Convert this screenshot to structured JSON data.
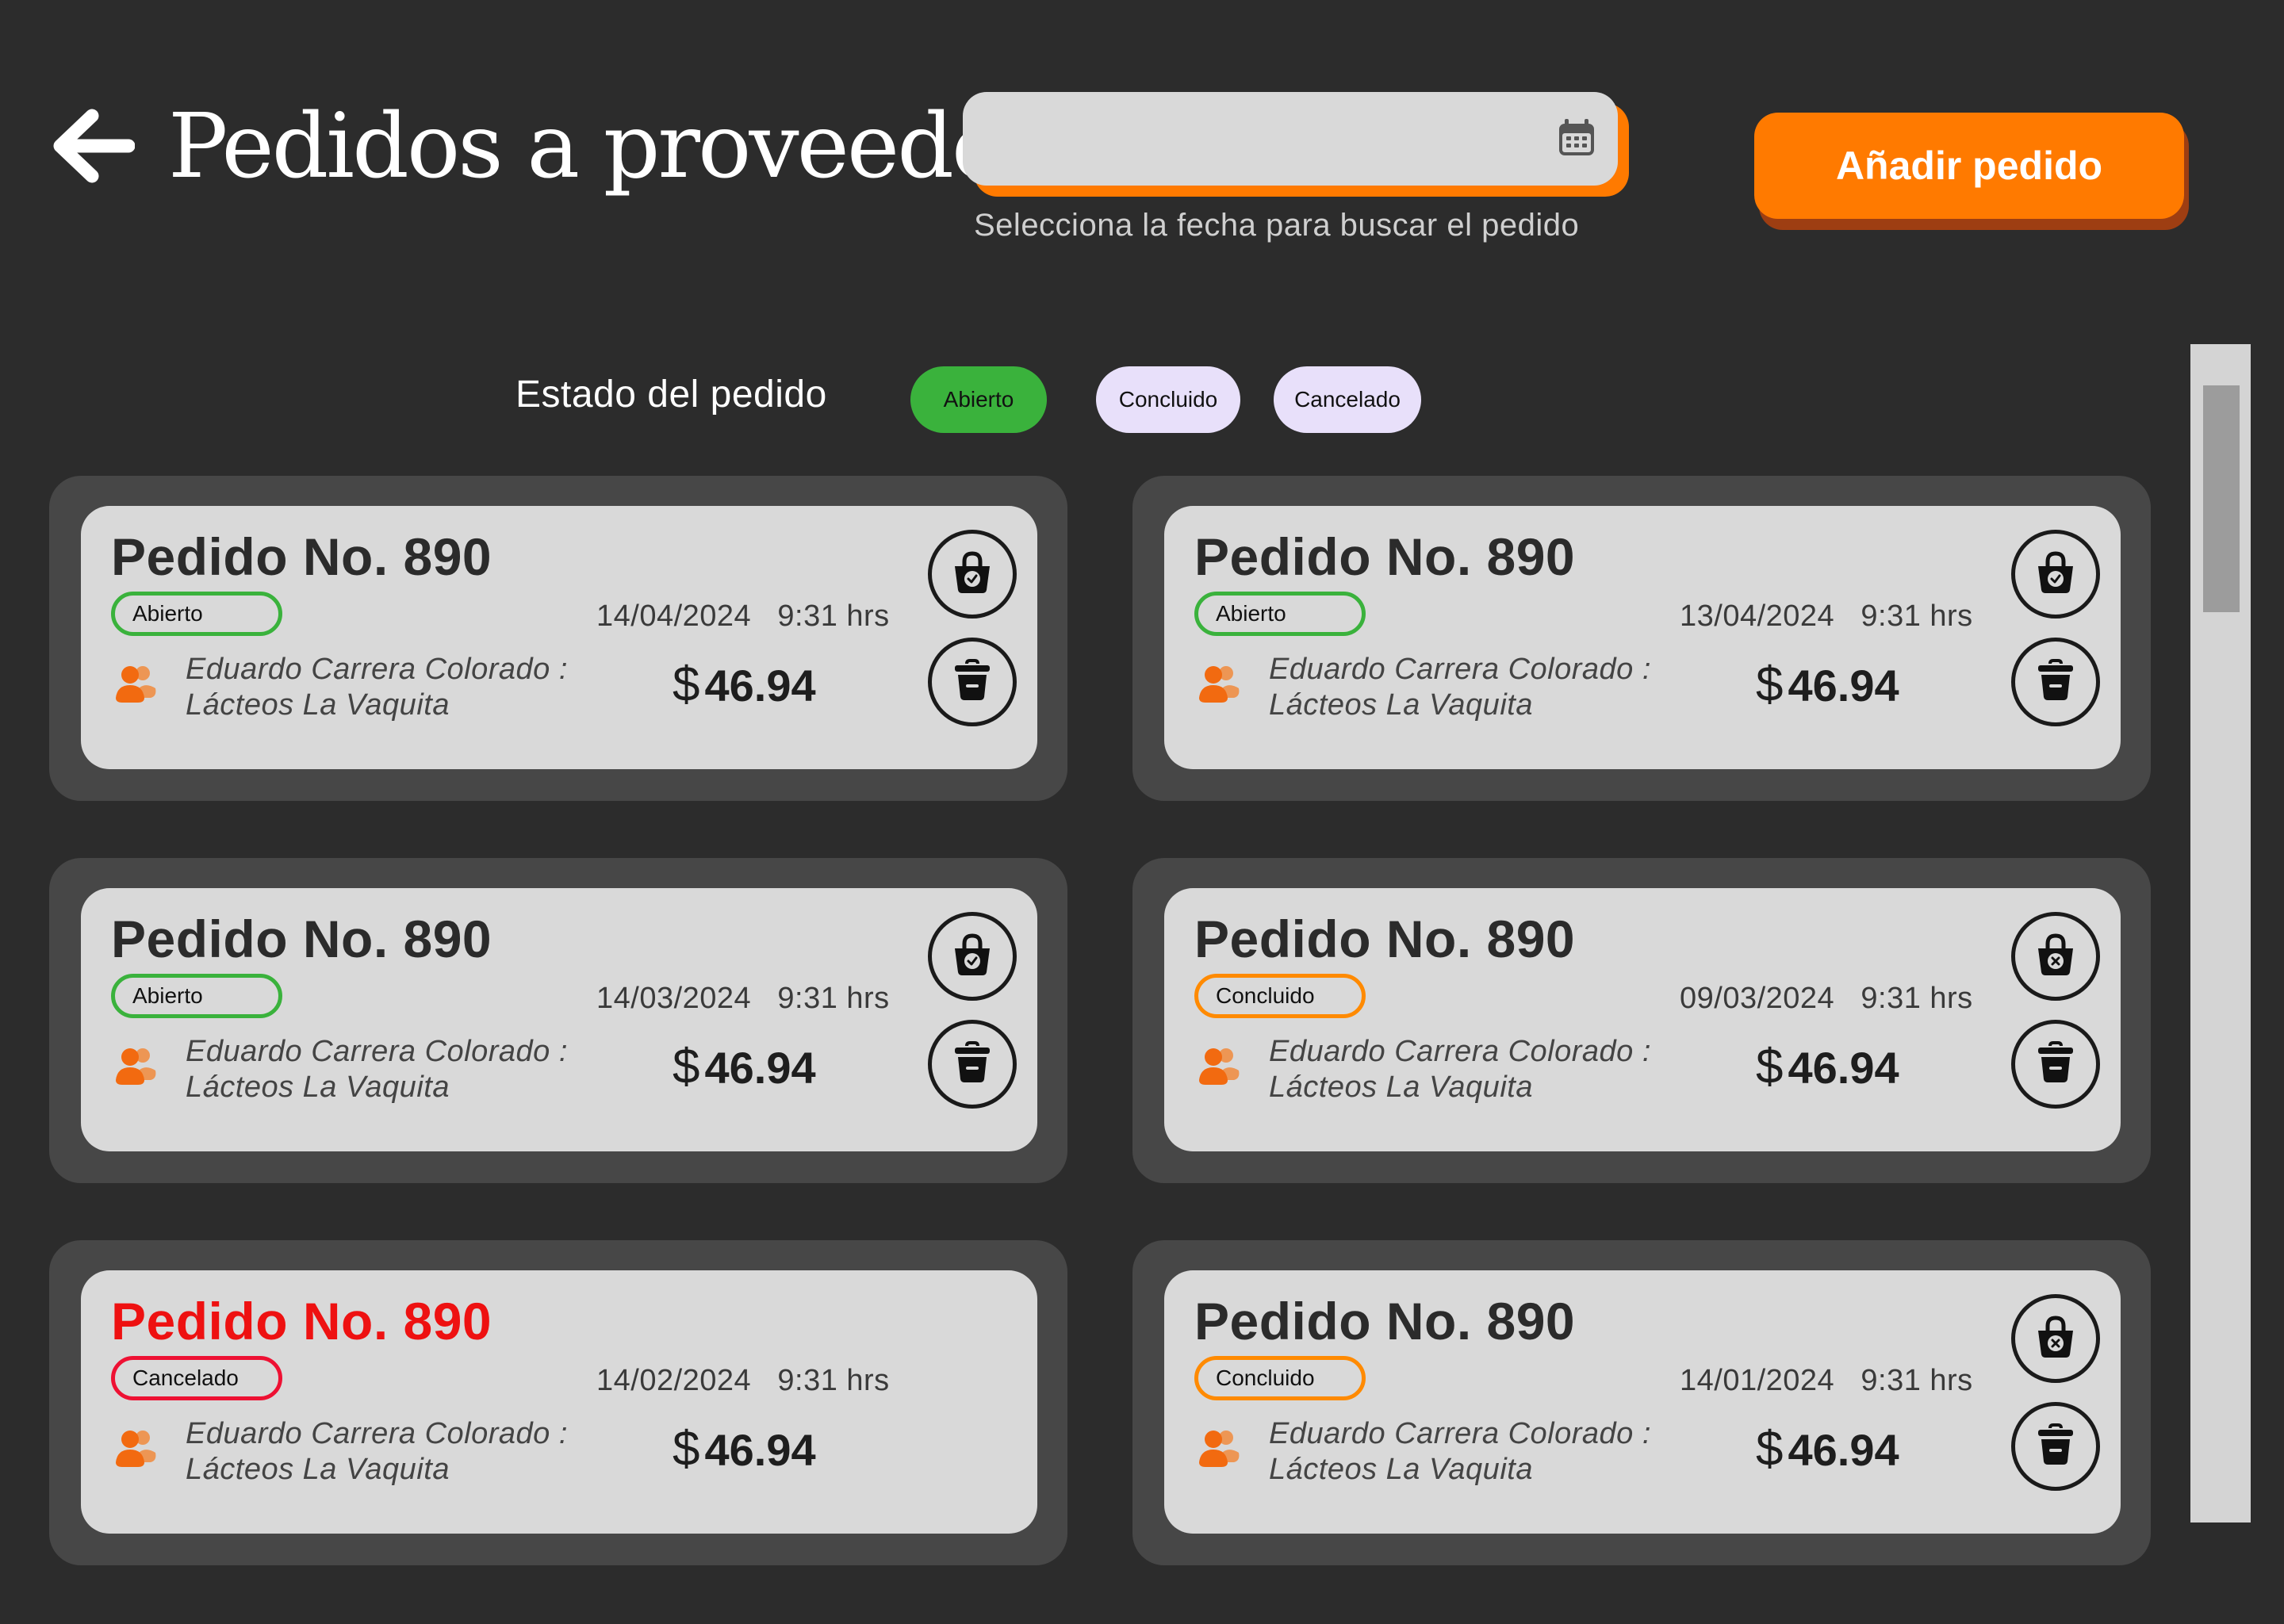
{
  "header": {
    "title": "Pedidos a proveedor",
    "date_hint": "Selecciona la fecha para buscar el pedido",
    "date_value": "",
    "add_label": "Añadir pedido"
  },
  "filter": {
    "label": "Estado del pedido",
    "chips": [
      "Abierto",
      "Concluido",
      "Cancelado"
    ]
  },
  "colors": {
    "accent": "#ff7a00",
    "open": "#3ab23c",
    "concluded": "#ff8a00",
    "cancelled": "#ee1133"
  },
  "orders": [
    {
      "title": "Pedido No. 890",
      "status": "Abierto",
      "date": "14/04/2024",
      "time": "9:31 hrs",
      "supplier_line1": "Eduardo Carrera Colorado :",
      "supplier_line2": "Lácteos La Vaquita",
      "currency": "$",
      "amount": "46.94",
      "basket_icon": "basket-check-icon"
    },
    {
      "title": "Pedido No. 890",
      "status": "Abierto",
      "date": "13/04/2024",
      "time": "9:31 hrs",
      "supplier_line1": "Eduardo Carrera Colorado :",
      "supplier_line2": "Lácteos La Vaquita",
      "currency": "$",
      "amount": "46.94",
      "basket_icon": "basket-check-icon"
    },
    {
      "title": "Pedido No. 890",
      "status": "Abierto",
      "date": "14/03/2024",
      "time": "9:31 hrs",
      "supplier_line1": "Eduardo Carrera Colorado :",
      "supplier_line2": "Lácteos La Vaquita",
      "currency": "$",
      "amount": "46.94",
      "basket_icon": "basket-check-icon"
    },
    {
      "title": "Pedido No. 890",
      "status": "Concluido",
      "date": "09/03/2024",
      "time": "9:31 hrs",
      "supplier_line1": "Eduardo Carrera Colorado :",
      "supplier_line2": "Lácteos La Vaquita",
      "currency": "$",
      "amount": "46.94",
      "basket_icon": "basket-x-icon"
    },
    {
      "title": "Pedido No. 890",
      "status": "Cancelado",
      "date": "14/02/2024",
      "time": "9:31 hrs",
      "supplier_line1": "Eduardo Carrera Colorado :",
      "supplier_line2": "Lácteos La Vaquita",
      "currency": "$",
      "amount": "46.94",
      "basket_icon": ""
    },
    {
      "title": "Pedido No. 890",
      "status": "Concluido",
      "date": "14/01/2024",
      "time": "9:31 hrs",
      "supplier_line1": "Eduardo Carrera Colorado :",
      "supplier_line2": "Lácteos La Vaquita",
      "currency": "$",
      "amount": "46.94",
      "basket_icon": "basket-x-icon"
    }
  ]
}
